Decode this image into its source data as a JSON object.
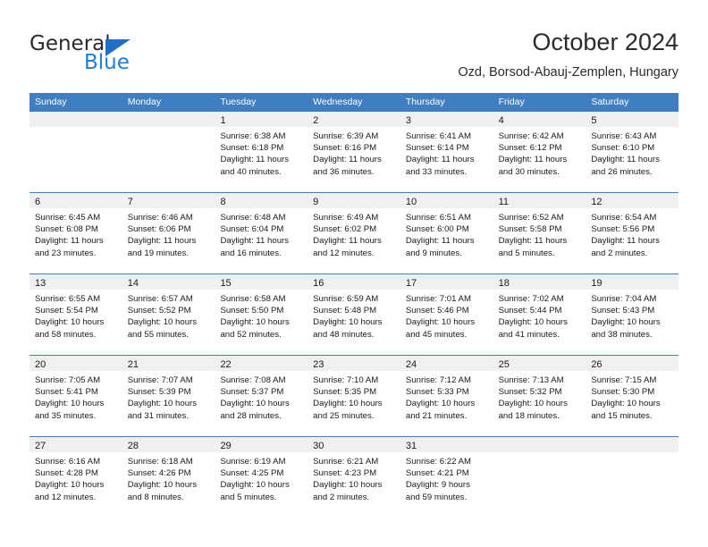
{
  "brand": {
    "name_part1": "General",
    "name_part2": "Blue",
    "triangle_icon": "triangle-icon",
    "accent_color": "#1f7fd4"
  },
  "header": {
    "title": "October 2024",
    "subtitle": "Ozd, Borsod-Abauj-Zemplen, Hungary"
  },
  "theme": {
    "header_blue": "#3f7fc1",
    "band_gray": "#f0f0f0",
    "text_color": "#1a1a1a"
  },
  "weekdays": [
    "Sunday",
    "Monday",
    "Tuesday",
    "Wednesday",
    "Thursday",
    "Friday",
    "Saturday"
  ],
  "weeks": [
    [
      {
        "day": "",
        "sunrise": "",
        "sunset": "",
        "daylight_line1": "",
        "daylight_line2": ""
      },
      {
        "day": "",
        "sunrise": "",
        "sunset": "",
        "daylight_line1": "",
        "daylight_line2": ""
      },
      {
        "day": "1",
        "sunrise": "Sunrise: 6:38 AM",
        "sunset": "Sunset: 6:18 PM",
        "daylight_line1": "Daylight: 11 hours",
        "daylight_line2": "and 40 minutes."
      },
      {
        "day": "2",
        "sunrise": "Sunrise: 6:39 AM",
        "sunset": "Sunset: 6:16 PM",
        "daylight_line1": "Daylight: 11 hours",
        "daylight_line2": "and 36 minutes."
      },
      {
        "day": "3",
        "sunrise": "Sunrise: 6:41 AM",
        "sunset": "Sunset: 6:14 PM",
        "daylight_line1": "Daylight: 11 hours",
        "daylight_line2": "and 33 minutes."
      },
      {
        "day": "4",
        "sunrise": "Sunrise: 6:42 AM",
        "sunset": "Sunset: 6:12 PM",
        "daylight_line1": "Daylight: 11 hours",
        "daylight_line2": "and 30 minutes."
      },
      {
        "day": "5",
        "sunrise": "Sunrise: 6:43 AM",
        "sunset": "Sunset: 6:10 PM",
        "daylight_line1": "Daylight: 11 hours",
        "daylight_line2": "and 26 minutes."
      }
    ],
    [
      {
        "day": "6",
        "sunrise": "Sunrise: 6:45 AM",
        "sunset": "Sunset: 6:08 PM",
        "daylight_line1": "Daylight: 11 hours",
        "daylight_line2": "and 23 minutes."
      },
      {
        "day": "7",
        "sunrise": "Sunrise: 6:46 AM",
        "sunset": "Sunset: 6:06 PM",
        "daylight_line1": "Daylight: 11 hours",
        "daylight_line2": "and 19 minutes."
      },
      {
        "day": "8",
        "sunrise": "Sunrise: 6:48 AM",
        "sunset": "Sunset: 6:04 PM",
        "daylight_line1": "Daylight: 11 hours",
        "daylight_line2": "and 16 minutes."
      },
      {
        "day": "9",
        "sunrise": "Sunrise: 6:49 AM",
        "sunset": "Sunset: 6:02 PM",
        "daylight_line1": "Daylight: 11 hours",
        "daylight_line2": "and 12 minutes."
      },
      {
        "day": "10",
        "sunrise": "Sunrise: 6:51 AM",
        "sunset": "Sunset: 6:00 PM",
        "daylight_line1": "Daylight: 11 hours",
        "daylight_line2": "and 9 minutes."
      },
      {
        "day": "11",
        "sunrise": "Sunrise: 6:52 AM",
        "sunset": "Sunset: 5:58 PM",
        "daylight_line1": "Daylight: 11 hours",
        "daylight_line2": "and 5 minutes."
      },
      {
        "day": "12",
        "sunrise": "Sunrise: 6:54 AM",
        "sunset": "Sunset: 5:56 PM",
        "daylight_line1": "Daylight: 11 hours",
        "daylight_line2": "and 2 minutes."
      }
    ],
    [
      {
        "day": "13",
        "sunrise": "Sunrise: 6:55 AM",
        "sunset": "Sunset: 5:54 PM",
        "daylight_line1": "Daylight: 10 hours",
        "daylight_line2": "and 58 minutes."
      },
      {
        "day": "14",
        "sunrise": "Sunrise: 6:57 AM",
        "sunset": "Sunset: 5:52 PM",
        "daylight_line1": "Daylight: 10 hours",
        "daylight_line2": "and 55 minutes."
      },
      {
        "day": "15",
        "sunrise": "Sunrise: 6:58 AM",
        "sunset": "Sunset: 5:50 PM",
        "daylight_line1": "Daylight: 10 hours",
        "daylight_line2": "and 52 minutes."
      },
      {
        "day": "16",
        "sunrise": "Sunrise: 6:59 AM",
        "sunset": "Sunset: 5:48 PM",
        "daylight_line1": "Daylight: 10 hours",
        "daylight_line2": "and 48 minutes."
      },
      {
        "day": "17",
        "sunrise": "Sunrise: 7:01 AM",
        "sunset": "Sunset: 5:46 PM",
        "daylight_line1": "Daylight: 10 hours",
        "daylight_line2": "and 45 minutes."
      },
      {
        "day": "18",
        "sunrise": "Sunrise: 7:02 AM",
        "sunset": "Sunset: 5:44 PM",
        "daylight_line1": "Daylight: 10 hours",
        "daylight_line2": "and 41 minutes."
      },
      {
        "day": "19",
        "sunrise": "Sunrise: 7:04 AM",
        "sunset": "Sunset: 5:43 PM",
        "daylight_line1": "Daylight: 10 hours",
        "daylight_line2": "and 38 minutes."
      }
    ],
    [
      {
        "day": "20",
        "sunrise": "Sunrise: 7:05 AM",
        "sunset": "Sunset: 5:41 PM",
        "daylight_line1": "Daylight: 10 hours",
        "daylight_line2": "and 35 minutes."
      },
      {
        "day": "21",
        "sunrise": "Sunrise: 7:07 AM",
        "sunset": "Sunset: 5:39 PM",
        "daylight_line1": "Daylight: 10 hours",
        "daylight_line2": "and 31 minutes."
      },
      {
        "day": "22",
        "sunrise": "Sunrise: 7:08 AM",
        "sunset": "Sunset: 5:37 PM",
        "daylight_line1": "Daylight: 10 hours",
        "daylight_line2": "and 28 minutes."
      },
      {
        "day": "23",
        "sunrise": "Sunrise: 7:10 AM",
        "sunset": "Sunset: 5:35 PM",
        "daylight_line1": "Daylight: 10 hours",
        "daylight_line2": "and 25 minutes."
      },
      {
        "day": "24",
        "sunrise": "Sunrise: 7:12 AM",
        "sunset": "Sunset: 5:33 PM",
        "daylight_line1": "Daylight: 10 hours",
        "daylight_line2": "and 21 minutes."
      },
      {
        "day": "25",
        "sunrise": "Sunrise: 7:13 AM",
        "sunset": "Sunset: 5:32 PM",
        "daylight_line1": "Daylight: 10 hours",
        "daylight_line2": "and 18 minutes."
      },
      {
        "day": "26",
        "sunrise": "Sunrise: 7:15 AM",
        "sunset": "Sunset: 5:30 PM",
        "daylight_line1": "Daylight: 10 hours",
        "daylight_line2": "and 15 minutes."
      }
    ],
    [
      {
        "day": "27",
        "sunrise": "Sunrise: 6:16 AM",
        "sunset": "Sunset: 4:28 PM",
        "daylight_line1": "Daylight: 10 hours",
        "daylight_line2": "and 12 minutes."
      },
      {
        "day": "28",
        "sunrise": "Sunrise: 6:18 AM",
        "sunset": "Sunset: 4:26 PM",
        "daylight_line1": "Daylight: 10 hours",
        "daylight_line2": "and 8 minutes."
      },
      {
        "day": "29",
        "sunrise": "Sunrise: 6:19 AM",
        "sunset": "Sunset: 4:25 PM",
        "daylight_line1": "Daylight: 10 hours",
        "daylight_line2": "and 5 minutes."
      },
      {
        "day": "30",
        "sunrise": "Sunrise: 6:21 AM",
        "sunset": "Sunset: 4:23 PM",
        "daylight_line1": "Daylight: 10 hours",
        "daylight_line2": "and 2 minutes."
      },
      {
        "day": "31",
        "sunrise": "Sunrise: 6:22 AM",
        "sunset": "Sunset: 4:21 PM",
        "daylight_line1": "Daylight: 9 hours",
        "daylight_line2": "and 59 minutes."
      },
      {
        "day": "",
        "sunrise": "",
        "sunset": "",
        "daylight_line1": "",
        "daylight_line2": ""
      },
      {
        "day": "",
        "sunrise": "",
        "sunset": "",
        "daylight_line1": "",
        "daylight_line2": ""
      }
    ]
  ]
}
